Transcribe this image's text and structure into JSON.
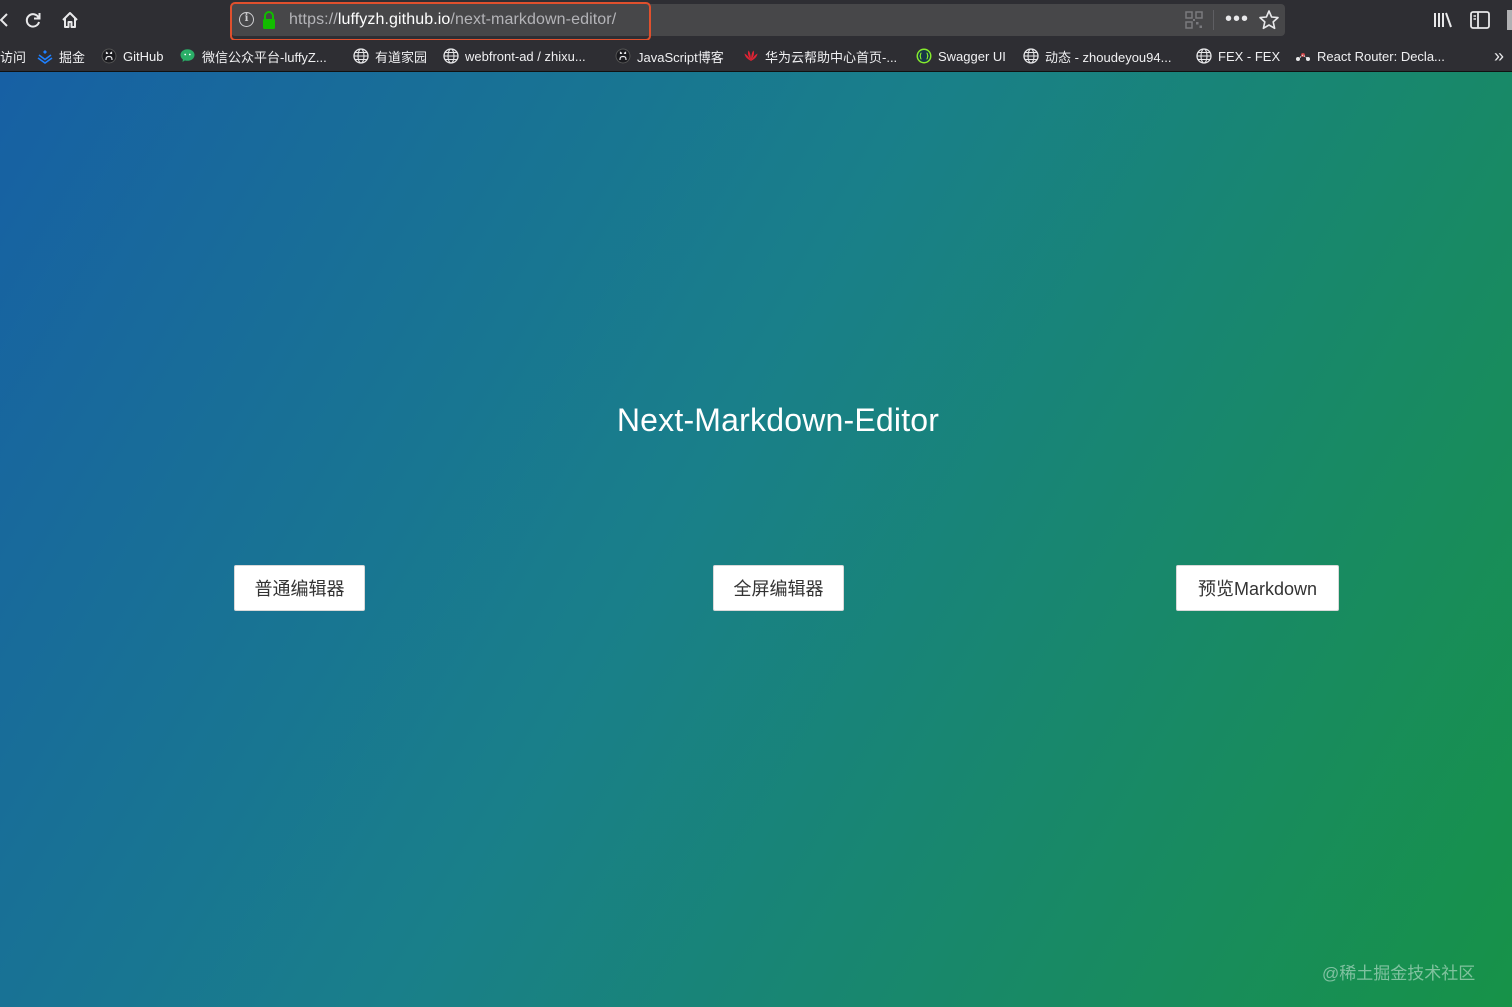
{
  "browser": {
    "url": {
      "scheme": "https://",
      "host": "luffyzh.github.io",
      "path": "/next-markdown-editor/"
    },
    "icons": [
      "back-icon",
      "reload-icon",
      "home-icon",
      "info-icon",
      "lock-icon",
      "qr-code-icon",
      "more-icon",
      "star-icon",
      "library-icon",
      "sidebar-icon"
    ]
  },
  "bookmarks": {
    "items": [
      {
        "label": "访问",
        "icon": "none"
      },
      {
        "label": "掘金",
        "icon": "juejin-icon"
      },
      {
        "label": "GitHub",
        "icon": "github-icon"
      },
      {
        "label": "微信公众平台-luffyZ...",
        "icon": "wechat-icon"
      },
      {
        "label": "有道家园",
        "icon": "globe-icon"
      },
      {
        "label": "webfront-ad / zhixu...",
        "icon": "globe-icon"
      },
      {
        "label": "JavaScript博客",
        "icon": "github-icon"
      },
      {
        "label": "华为云帮助中心首页-...",
        "icon": "huawei-icon"
      },
      {
        "label": "Swagger UI",
        "icon": "swagger-icon"
      },
      {
        "label": "动态 - zhoudeyou94...",
        "icon": "globe-icon"
      },
      {
        "label": "FEX - FEX",
        "icon": "globe-icon"
      },
      {
        "label": "React Router: Decla...",
        "icon": "react-router-icon"
      }
    ],
    "overflow": "»"
  },
  "page": {
    "title": "Next-Markdown-Editor",
    "buttons": {
      "normal_editor": "普通编辑器",
      "fullscreen_editor": "全屏编辑器",
      "preview_markdown": "预览Markdown"
    },
    "watermark": "@稀土掘金技术社区"
  },
  "colors": {
    "accent_highlight": "#e0502d",
    "gradient_start": "#1760a4",
    "gradient_end": "#179248",
    "lock_green": "#12bc00"
  }
}
